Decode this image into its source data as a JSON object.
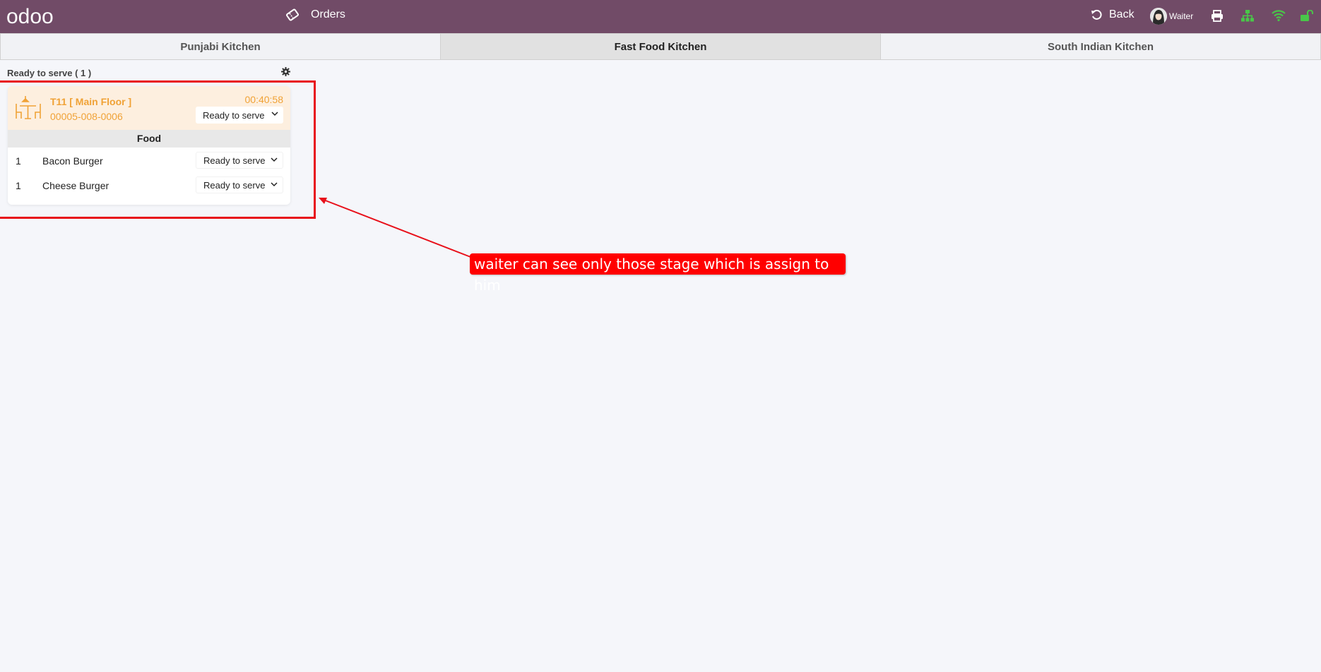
{
  "topbar": {
    "logo_text": "odoo",
    "orders_label": "Orders",
    "back_label": "Back",
    "user_name": "Waiter",
    "bg_color": "#714b67",
    "icons": [
      "ticket-icon",
      "undo-icon",
      "print-icon",
      "sitemap-icon",
      "wifi-icon",
      "unlock-icon"
    ],
    "status_color": "#49c649"
  },
  "tabs": [
    {
      "label": "Punjabi Kitchen",
      "active": false
    },
    {
      "label": "Fast Food Kitchen",
      "active": true
    },
    {
      "label": "South Indian Kitchen",
      "active": false
    }
  ],
  "stage": {
    "title": "Ready to serve ( 1 )"
  },
  "order": {
    "table": "T11 [ Main Floor ]",
    "reference": "00005-008-0006",
    "timer": "00:40:58",
    "status": "Ready to serve",
    "accent_color": "#f0a236",
    "category": "Food",
    "items": [
      {
        "qty": "1",
        "name": "Bacon Burger",
        "status": "Ready to serve"
      },
      {
        "qty": "1",
        "name": "Cheese Burger",
        "status": "Ready to serve"
      }
    ]
  },
  "annotation": {
    "text": "waiter can see only those stage which is assign to him",
    "color": "#ff0000"
  }
}
